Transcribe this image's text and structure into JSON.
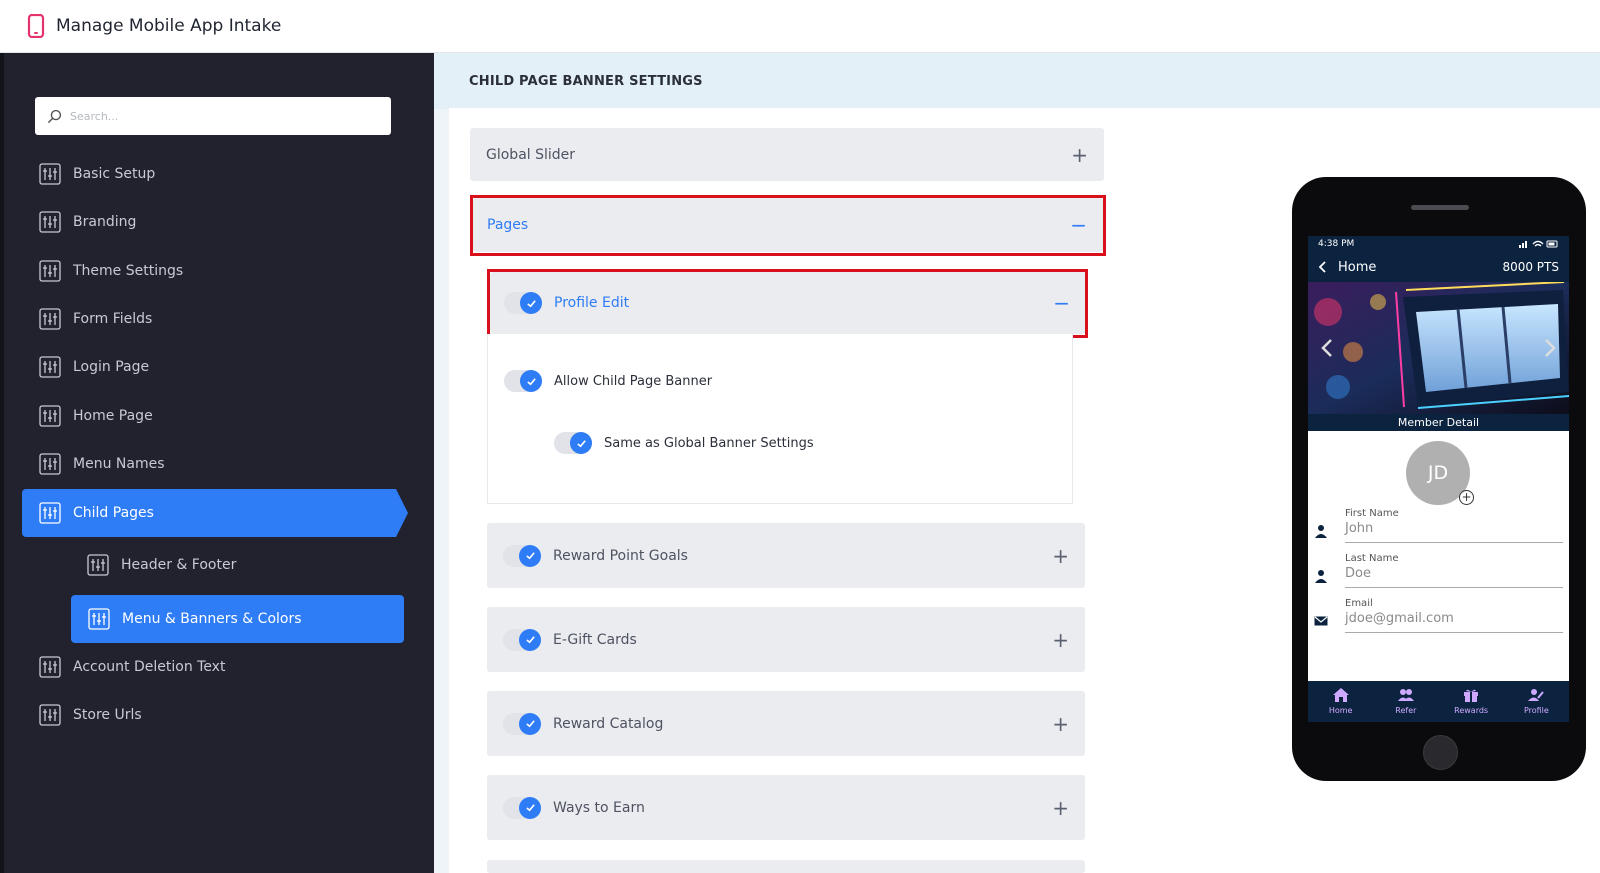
{
  "app": {
    "title": "Manage Mobile App Intake"
  },
  "search": {
    "placeholder": "Search..."
  },
  "sidebar": {
    "items": [
      {
        "label": "Basic Setup"
      },
      {
        "label": "Branding"
      },
      {
        "label": "Theme Settings"
      },
      {
        "label": "Form Fields"
      },
      {
        "label": "Login Page"
      },
      {
        "label": "Home Page"
      },
      {
        "label": "Menu Names"
      },
      {
        "label": "Child Pages",
        "active": true
      },
      {
        "label": "Header & Footer"
      },
      {
        "label": "Menu & Banners & Colors",
        "active": true
      },
      {
        "label": "Account Deletion Text"
      },
      {
        "label": "Store Urls"
      }
    ]
  },
  "main": {
    "section_title": "CHILD PAGE BANNER SETTINGS",
    "global_slider": {
      "label": "Global Slider",
      "sign": "+"
    },
    "pages": {
      "label": "Pages",
      "sign": "−"
    },
    "profile_edit": {
      "label": "Profile Edit",
      "sign": "−",
      "enabled": true
    },
    "options": {
      "allow_banner": {
        "label": "Allow Child Page Banner",
        "enabled": true
      },
      "same_as_global": {
        "label": "Same as Global Banner Settings",
        "enabled": true
      }
    },
    "child_pages": [
      {
        "label": "Reward Point Goals",
        "sign": "+",
        "enabled": true
      },
      {
        "label": "E-Gift Cards",
        "sign": "+",
        "enabled": true
      },
      {
        "label": "Reward Catalog",
        "sign": "+",
        "enabled": true
      },
      {
        "label": "Ways to Earn",
        "sign": "+",
        "enabled": true
      }
    ]
  },
  "phone": {
    "time": "4:38 PM",
    "appbar_title": "Home",
    "points": "8000 PTS",
    "member_title": "Member Detail",
    "avatar_initials": "JD",
    "avatar_add": "+",
    "fields": [
      {
        "label": "First Name",
        "value": "John",
        "icon": "person-icon"
      },
      {
        "label": "Last Name",
        "value": "Doe",
        "icon": "person-icon"
      },
      {
        "label": "Email",
        "value": "jdoe@gmail.com",
        "icon": "mail-icon"
      }
    ],
    "tabs": [
      {
        "label": "Home",
        "icon": "home-icon"
      },
      {
        "label": "Refer",
        "icon": "people-icon"
      },
      {
        "label": "Rewards",
        "icon": "gift-icon"
      },
      {
        "label": "Profile",
        "icon": "profile-edit-icon"
      }
    ]
  },
  "colors": {
    "accent": "#2e7cf6",
    "sidebar": "#21222d",
    "highlight": "#d8101c",
    "phone_navy": "#0c2340",
    "brand_pink": "#e5336b"
  }
}
